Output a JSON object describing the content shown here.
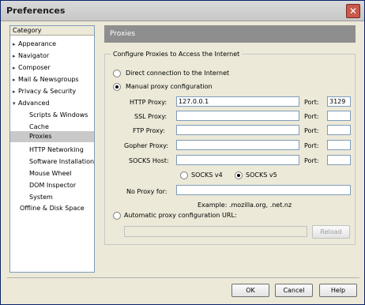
{
  "window": {
    "title": "Preferences"
  },
  "sidebar": {
    "header": "Category",
    "items": [
      {
        "label": "Appearance",
        "twisty": "▸"
      },
      {
        "label": "Navigator",
        "twisty": "▸"
      },
      {
        "label": "Composer",
        "twisty": "▸"
      },
      {
        "label": "Mail & Newsgroups",
        "twisty": "▸"
      },
      {
        "label": "Privacy & Security",
        "twisty": "▸"
      },
      {
        "label": "Advanced",
        "twisty": "▾"
      },
      {
        "label": "Scripts & Windows"
      },
      {
        "label": "Cache"
      },
      {
        "label": "Proxies"
      },
      {
        "label": "HTTP Networking"
      },
      {
        "label": "Software Installation"
      },
      {
        "label": "Mouse Wheel"
      },
      {
        "label": "DOM Inspector"
      },
      {
        "label": "System"
      },
      {
        "label": "Offline & Disk Space"
      }
    ]
  },
  "panel": {
    "title": "Proxies",
    "group_label": "Configure Proxies to Access the Internet",
    "direct_label": "Direct connection to the Internet",
    "manual_label": "Manual proxy configuration",
    "http_label": "HTTP Proxy:",
    "http_value": "127.0.0.1",
    "ssl_label": "SSL Proxy:",
    "ftp_label": "FTP Proxy:",
    "gopher_label": "Gopher Proxy:",
    "socks_label": "SOCKS Host:",
    "port_label": "Port:",
    "http_port": "3129",
    "socks_v4_label": "SOCKS v4",
    "socks_v5_label": "SOCKS v5",
    "noproxy_label": "No Proxy for:",
    "noproxy_value": "",
    "example_text": "Example: .mozilla.org, .net.nz",
    "auto_label": "Automatic proxy configuration URL:",
    "auto_value": "",
    "reload_label": "Reload"
  },
  "buttons": {
    "ok": "OK",
    "cancel": "Cancel",
    "help": "Help"
  }
}
